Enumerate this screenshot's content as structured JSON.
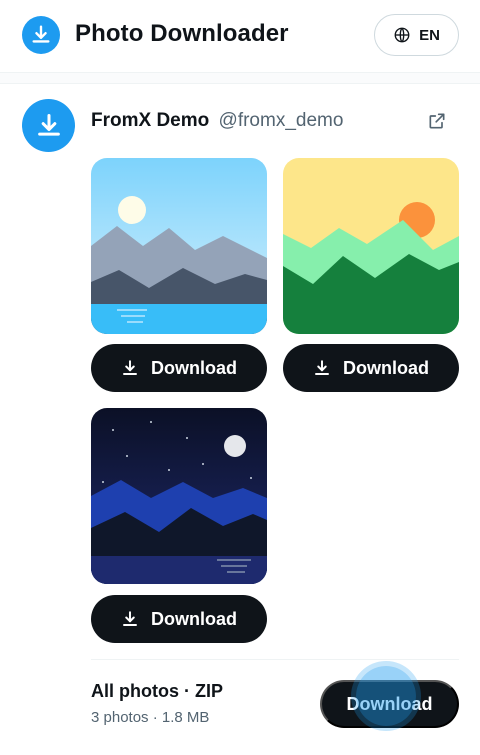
{
  "app": {
    "title": "Photo Downloader",
    "language_label": "EN",
    "accent_color": "#1d9bf0"
  },
  "profile": {
    "display_name": "FromX Demo",
    "handle": "@fromx_demo"
  },
  "photos": [
    {
      "theme": "blue-mountains-lake-sun",
      "button_label": "Download"
    },
    {
      "theme": "sunrise-green-hills",
      "button_label": "Download"
    },
    {
      "theme": "night-mountains-moon",
      "button_label": "Download"
    }
  ],
  "zip": {
    "title": "All photos · ZIP",
    "meta": "3 photos · 1.8 MB",
    "button_label": "Download"
  },
  "icons": {
    "logo": "download-icon",
    "language": "globe-icon",
    "external": "external-link-icon",
    "download": "download-arrow-icon"
  }
}
